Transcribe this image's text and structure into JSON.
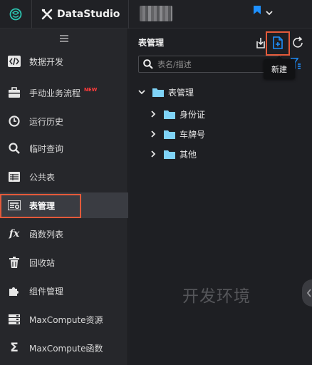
{
  "topbar": {
    "brand": "DataStudio",
    "accent_color": "#1e90ff"
  },
  "sidebar": {
    "items": [
      {
        "label": "数据开发",
        "icon": "code-icon",
        "badge": ""
      },
      {
        "label": "手动业务流程",
        "icon": "briefcase-icon",
        "badge": "NEW"
      },
      {
        "label": "运行历史",
        "icon": "clock-icon",
        "badge": ""
      },
      {
        "label": "临时查询",
        "icon": "search-icon",
        "badge": ""
      },
      {
        "label": "公共表",
        "icon": "table-icon",
        "badge": ""
      },
      {
        "label": "表管理",
        "icon": "table-manage-icon",
        "badge": "",
        "active": true
      },
      {
        "label": "函数列表",
        "icon": "fx-icon",
        "badge": ""
      },
      {
        "label": "回收站",
        "icon": "trash-icon",
        "badge": ""
      },
      {
        "label": "组件管理",
        "icon": "puzzle-icon",
        "badge": ""
      },
      {
        "label": "MaxCompute资源",
        "icon": "server-icon",
        "badge": ""
      },
      {
        "label": "MaxCompute函数",
        "icon": "sigma-icon",
        "badge": ""
      }
    ]
  },
  "panel": {
    "title": "表管理",
    "search_placeholder": "表名/描述",
    "tooltip": "新建",
    "tree": {
      "root": "表管理",
      "children": [
        "身份证",
        "车牌号",
        "其他"
      ]
    },
    "watermark": "开发环境",
    "highlight_color": "#e45a3a",
    "folder_color": "#7fd3f7"
  }
}
